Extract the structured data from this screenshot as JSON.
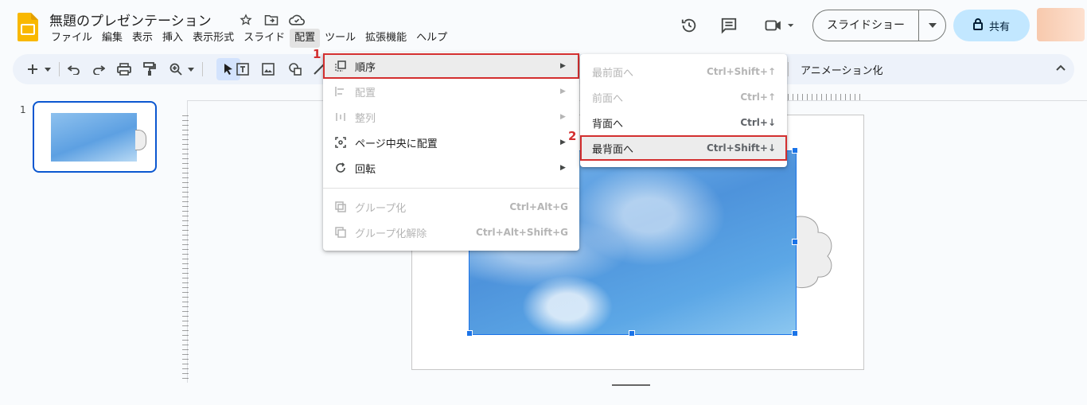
{
  "header": {
    "doc_title": "無題のプレゼンテーション",
    "menu": [
      "ファイル",
      "編集",
      "表示",
      "挿入",
      "表示形式",
      "スライド",
      "配置",
      "ツール",
      "拡張機能",
      "ヘルプ"
    ],
    "active_menu": "配置",
    "slideshow_label": "スライドショー",
    "share_label": "共有",
    "icons": [
      "history-icon",
      "comment-icon",
      "meet-icon",
      "lock-icon",
      "star-icon",
      "move-folder-icon",
      "cloud-status-icon"
    ]
  },
  "toolbar": {
    "animation_label": "アニメーション化",
    "icons": [
      "add-icon",
      "undo-icon",
      "redo-icon",
      "print-icon",
      "paint-format-icon",
      "zoom-icon",
      "select-icon",
      "textbox-icon",
      "image-icon",
      "shape-icon",
      "line-icon",
      "collapse-icon"
    ]
  },
  "filmstrip": {
    "slide_number": "1"
  },
  "arrange_menu": {
    "items": [
      {
        "label": "順序",
        "has_submenu": true,
        "disabled": false,
        "icon": "order-icon"
      },
      {
        "label": "配置",
        "has_submenu": true,
        "disabled": true,
        "icon": "align-icon"
      },
      {
        "label": "整列",
        "has_submenu": true,
        "disabled": true,
        "icon": "distribute-icon"
      },
      {
        "label": "ページ中央に配置",
        "has_submenu": true,
        "disabled": false,
        "icon": "center-on-page-icon"
      },
      {
        "label": "回転",
        "has_submenu": true,
        "disabled": false,
        "icon": "rotate-icon"
      },
      {
        "label": "グループ化",
        "shortcut": "Ctrl+Alt+G",
        "disabled": true,
        "icon": "group-icon"
      },
      {
        "label": "グループ化解除",
        "shortcut": "Ctrl+Alt+Shift+G",
        "disabled": true,
        "icon": "ungroup-icon"
      }
    ]
  },
  "order_submenu": {
    "items": [
      {
        "label": "最前面へ",
        "shortcut": "Ctrl+Shift+↑",
        "disabled": true
      },
      {
        "label": "前面へ",
        "shortcut": "Ctrl+↑",
        "disabled": true
      },
      {
        "label": "背面へ",
        "shortcut": "Ctrl+↓",
        "disabled": false
      },
      {
        "label": "最背面へ",
        "shortcut": "Ctrl+Shift+↓",
        "disabled": false
      }
    ]
  },
  "callouts": {
    "step1": "1",
    "step2": "2"
  },
  "colors": {
    "accent": "#0b57d0",
    "share_bg": "#c2e7ff",
    "toolbar_bg": "#edf2fa",
    "callout": "#d32f2f"
  }
}
